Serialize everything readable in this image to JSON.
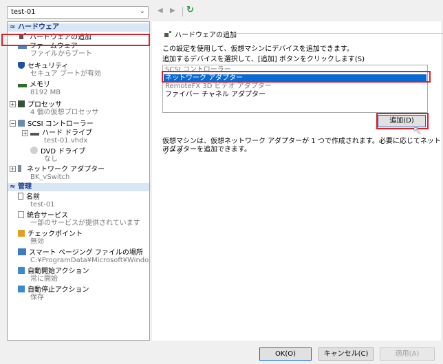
{
  "toolbar": {
    "vm_name": "test-01",
    "back": "◀",
    "forward": "▶",
    "refresh": "↻"
  },
  "tree": {
    "hardware_header": "ハードウェア",
    "management_header": "管理",
    "hardware_items": [
      {
        "label": "ハードウェアの追加",
        "sub": ""
      },
      {
        "label": "ファームウェア",
        "sub": "ファイルからブート"
      },
      {
        "label": "セキュリティ",
        "sub": "セキュア ブートが有効"
      },
      {
        "label": "メモリ",
        "sub": "8192 MB"
      },
      {
        "label": "プロセッサ",
        "sub": "4 個の仮想プロセッサ"
      },
      {
        "label": "SCSI コントローラー",
        "sub": ""
      },
      {
        "label": "ハード ドライブ",
        "sub": "test-01.vhdx"
      },
      {
        "label": "DVD ドライブ",
        "sub": "なし"
      },
      {
        "label": "ネットワーク アダプター",
        "sub": "BK_vSwitch"
      }
    ],
    "management_items": [
      {
        "label": "名前",
        "sub": "test-01"
      },
      {
        "label": "統合サービス",
        "sub": "一部のサービスが提供されています"
      },
      {
        "label": "チェックポイント",
        "sub": "無効"
      },
      {
        "label": "スマート ページング ファイルの場所",
        "sub": "C:¥ProgramData¥Microsoft¥Windo..."
      },
      {
        "label": "自動開始アクション",
        "sub": "常に開始"
      },
      {
        "label": "自動停止アクション",
        "sub": "保存"
      }
    ]
  },
  "panel": {
    "title": "ハードウェアの追加",
    "desc1": "この設定を使用して、仮想マシンにデバイスを追加できます。",
    "desc2": "追加するデバイスを選択して、[追加] ボタンをクリックします(S)",
    "devices": [
      "SCSI コントローラー",
      "ネットワーク アダプター",
      "RemoteFX 3D ビデオ アダプター",
      "ファイバー チャネル アダプター"
    ],
    "selected_device": "ネットワーク アダプター",
    "add_button": "追加(D)",
    "info1": "仮想マシンは、仮想ネットワーク アダプターが 1 つで作成されます。必要に応じてネットワーク",
    "info2": "アダプターを追加できます。"
  },
  "footer": {
    "ok": "OK(O)",
    "cancel": "キャンセル(C)",
    "apply": "適用(A)"
  },
  "colors": {
    "highlight": "#d9212c",
    "selection": "#0a6ad4",
    "section_header": "#1a3a8a"
  }
}
